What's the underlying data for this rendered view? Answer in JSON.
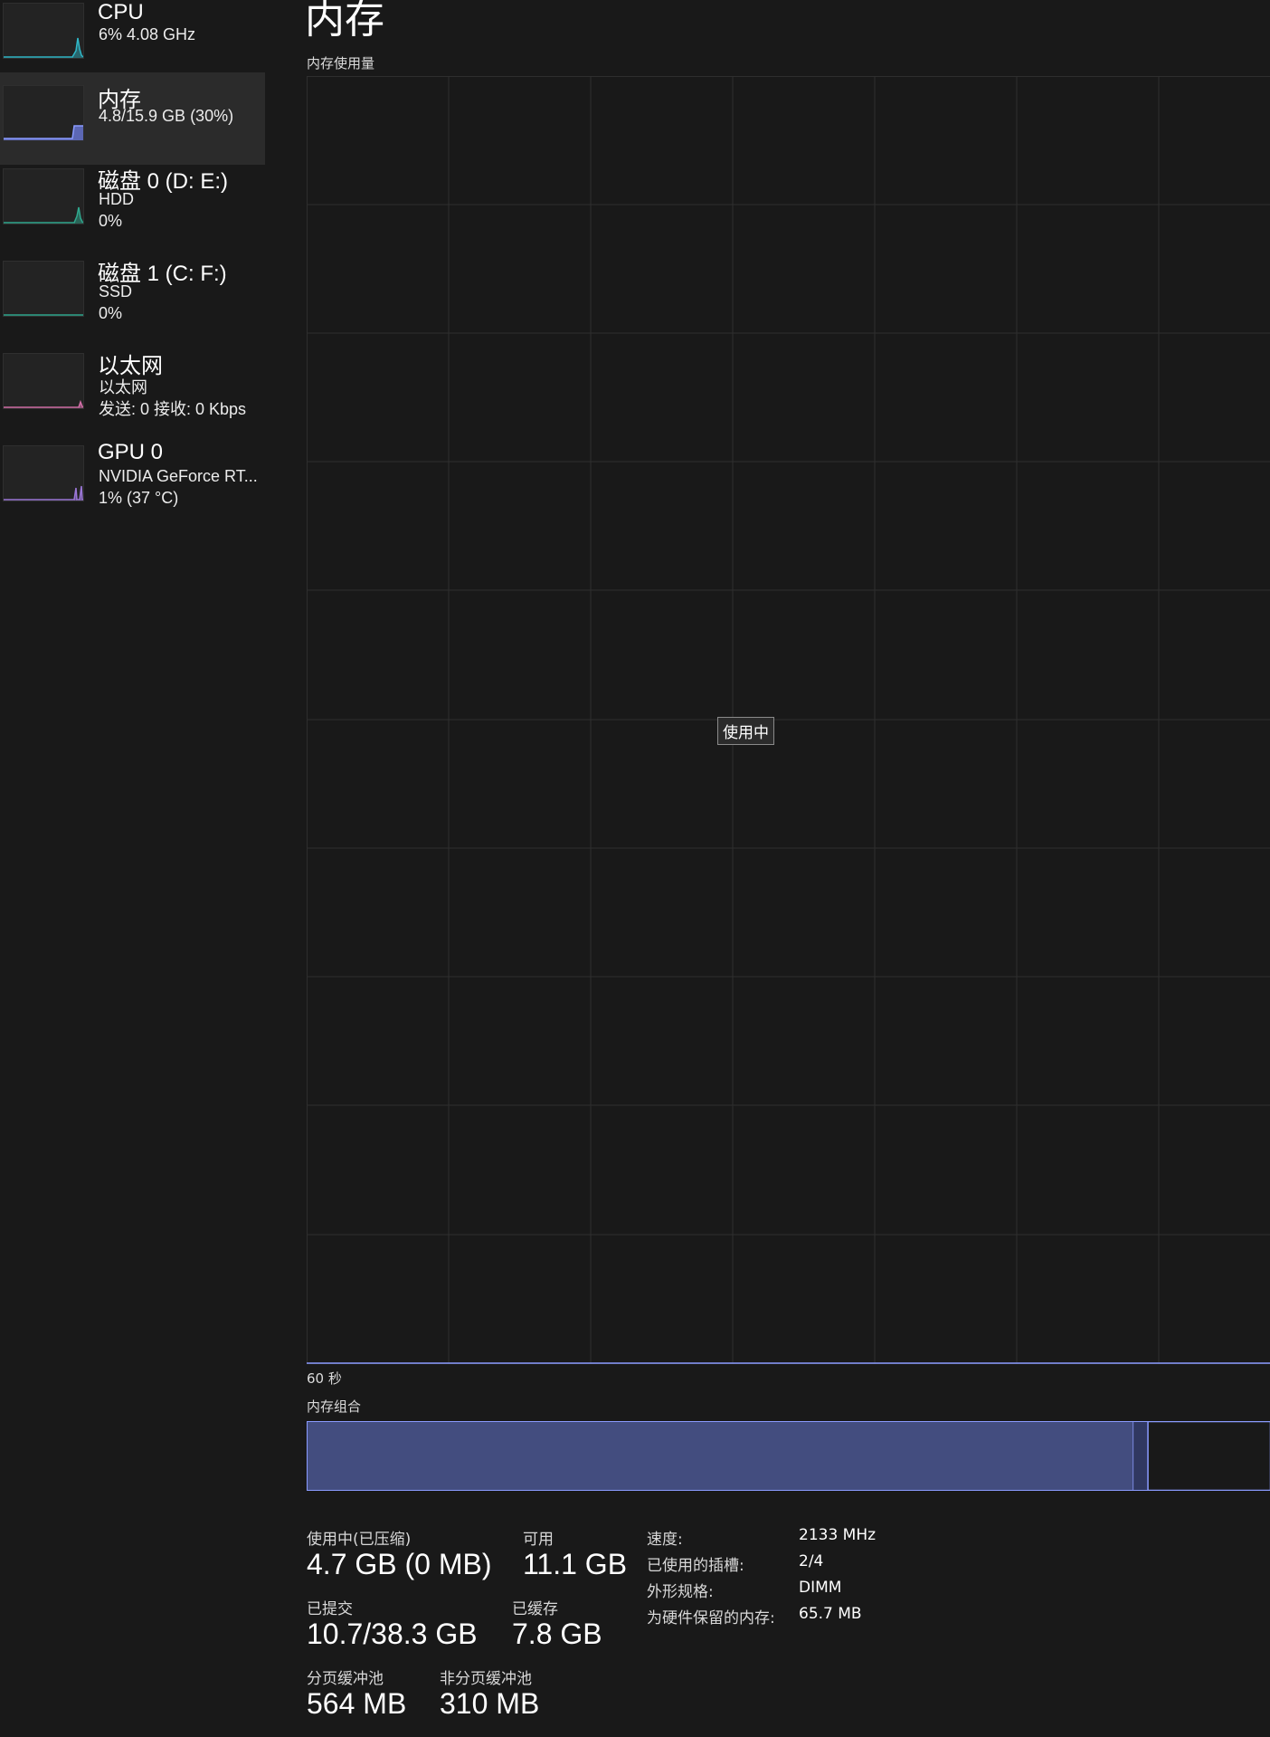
{
  "colors": {
    "background": "#191919",
    "memory_accent": "#8a9bff",
    "memory_fill": "#434d7f",
    "cpu_accent": "#2fb8c8",
    "disk_accent": "#2fa88e",
    "net_accent": "#d26fa8",
    "gpu_accent": "#9a76d6",
    "grid": "#2e2e2e"
  },
  "sidebar": {
    "items": [
      {
        "id": "cpu",
        "name": "CPU",
        "line1": "6%  4.08 GHz",
        "line2": "",
        "icon": "cpu-usage-thumbnail"
      },
      {
        "id": "memory",
        "name": "内存",
        "line1": "4.8/15.9 GB (30%)",
        "line2": "",
        "icon": "memory-usage-thumbnail",
        "selected": true
      },
      {
        "id": "disk0",
        "name": "磁盘 0 (D: E:)",
        "line1": "HDD",
        "line2": "0%",
        "icon": "disk-usage-thumbnail"
      },
      {
        "id": "disk1",
        "name": "磁盘 1 (C: F:)",
        "line1": "SSD",
        "line2": "0%",
        "icon": "disk-usage-thumbnail"
      },
      {
        "id": "ethernet",
        "name": "以太网",
        "line1": "以太网",
        "line2": "发送: 0  接收: 0 Kbps",
        "icon": "network-usage-thumbnail"
      },
      {
        "id": "gpu0",
        "name": "GPU 0",
        "line1": "NVIDIA GeForce RT...",
        "line2": "1%  (37 °C)",
        "icon": "gpu-usage-thumbnail"
      }
    ]
  },
  "main": {
    "title": "内存",
    "graph_label": "内存使用量",
    "tooltip": "使用中",
    "time_label": "60 秒",
    "composition_label": "内存组合",
    "in_use_fraction": 0.3,
    "modified_fraction": 0.015
  },
  "stats": {
    "in_use": {
      "label": "使用中(已压缩)",
      "value": "4.7 GB (0 MB)"
    },
    "available": {
      "label": "可用",
      "value": "11.1 GB"
    },
    "committed": {
      "label": "已提交",
      "value": "10.7/38.3 GB"
    },
    "cached": {
      "label": "已缓存",
      "value": "7.8 GB"
    },
    "paged_pool": {
      "label": "分页缓冲池",
      "value": "564 MB"
    },
    "non_paged_pool": {
      "label": "非分页缓冲池",
      "value": "310 MB"
    }
  },
  "properties": [
    {
      "label": "速度:",
      "value": "2133 MHz"
    },
    {
      "label": "已使用的插槽:",
      "value": "2/4"
    },
    {
      "label": "外形规格:",
      "value": "DIMM"
    },
    {
      "label": "为硬件保留的内存:",
      "value": "65.7 MB"
    }
  ]
}
